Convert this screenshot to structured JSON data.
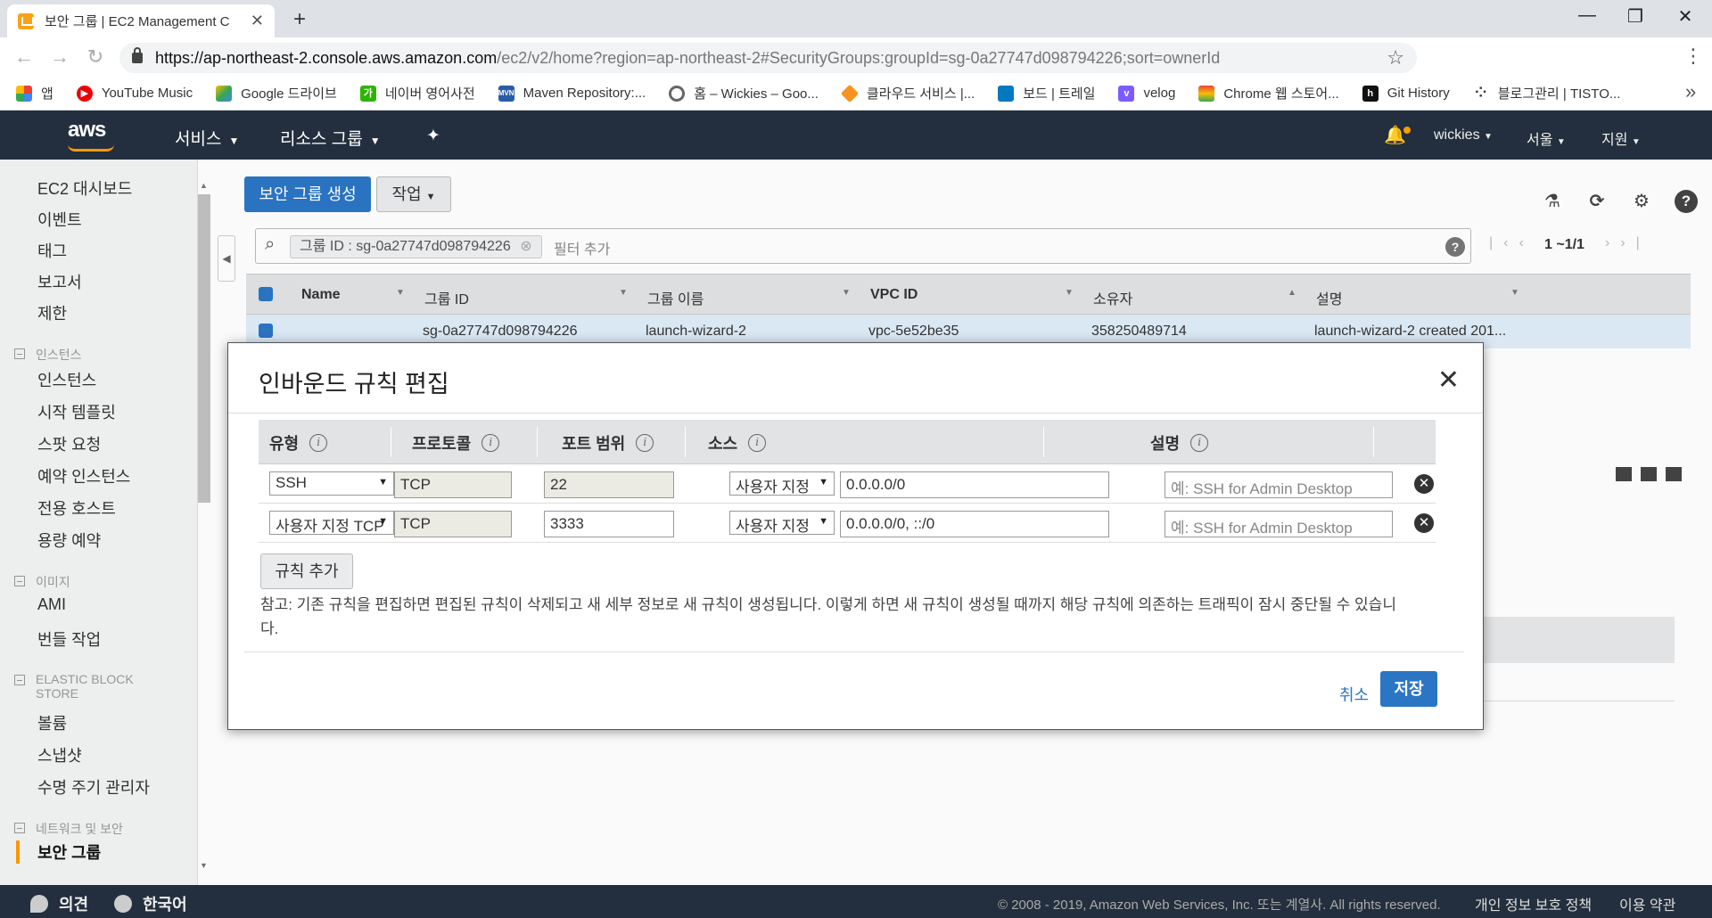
{
  "browser": {
    "tab_title": "보안 그룹 | EC2 Management C",
    "url_scheme_host": "https://ap-northeast-2.console.aws.amazon.com",
    "url_path": "/ec2/v2/home?region=ap-northeast-2#SecurityGroups:groupId=sg-0a27747d098794226;sort=ownerId",
    "bookmarks": [
      "앱",
      "YouTube Music",
      "Google 드라이브",
      "네이버 영어사전",
      "Maven Repository:...",
      "홈 – Wickies – Goo...",
      "클라우드 서비스 |...",
      "보드 | 트레일",
      "velog",
      "Chrome 웹 스토어...",
      "Git History",
      "블로그관리 | TISTO..."
    ]
  },
  "header": {
    "logo": "aws",
    "services": "서비스",
    "resource_groups": "리소스 그룹",
    "account": "wickies",
    "region": "서울",
    "support": "지원"
  },
  "sidebar": {
    "top_items": [
      "EC2 대시보드",
      "이벤트",
      "태그",
      "보고서",
      "제한"
    ],
    "sections": [
      {
        "title": "인스턴스",
        "items": [
          "인스턴스",
          "시작 템플릿",
          "스팟 요청",
          "예약 인스턴스",
          "전용 호스트",
          "용량 예약"
        ]
      },
      {
        "title": "이미지",
        "items": [
          "AMI",
          "번들 작업"
        ]
      },
      {
        "title": "ELASTIC BLOCK STORE",
        "items": [
          "볼륨",
          "스냅샷",
          "수명 주기 관리자"
        ]
      },
      {
        "title": "네트워크 및 보안",
        "items": [
          "보안 그룹"
        ]
      }
    ]
  },
  "toolbar": {
    "create_label": "보안 그룹 생성",
    "actions_label": "작업"
  },
  "filter": {
    "chip": "그룹 ID : sg-0a27747d098794226",
    "add_filter": "필터 추가",
    "pagination": "1 ~1/1"
  },
  "grid": {
    "columns": [
      "Name",
      "그룹 ID",
      "그룹 이름",
      "VPC ID",
      "소유자",
      "설명"
    ],
    "row": [
      "",
      "sg-0a27747d098794226",
      "launch-wizard-2",
      "vpc-5e52be35",
      "358250489714",
      "launch-wizard-2 created 201..."
    ]
  },
  "modal": {
    "title": "인바운드 규칙 편집",
    "columns": [
      "유형",
      "프로토콜",
      "포트 범위",
      "소스",
      "설명"
    ],
    "rules": [
      {
        "type": "SSH",
        "protocol": "TCP",
        "port": "22",
        "source_type": "사용자 지정",
        "source": "0.0.0.0/0",
        "description_placeholder": "예: SSH for Admin Desktop"
      },
      {
        "type": "사용자 지정 TCP",
        "protocol": "TCP",
        "port": "3333",
        "source_type": "사용자 지정",
        "source": "0.0.0.0/0, ::/0",
        "description_placeholder": "예: SSH for Admin Desktop"
      }
    ],
    "add_rule": "규칙 추가",
    "note": "참고: 기존 규칙을 편집하면 편집된 규칙이 삭제되고 새 세부 정보로 새 규칙이 생성됩니다. 이렇게 하면 새 규칙이 생성될 때까지 해당 규칙에 의존하는 트래픽이 잠시 중단될 수 있습니다.",
    "cancel": "취소",
    "save": "저장"
  },
  "footer": {
    "feedback": "의견",
    "language": "한국어",
    "copyright": "© 2008 - 2019, Amazon Web Services, Inc. 또는 계열사. All rights reserved.",
    "privacy": "개인 정보 보호 정책",
    "terms": "이용 약관"
  }
}
